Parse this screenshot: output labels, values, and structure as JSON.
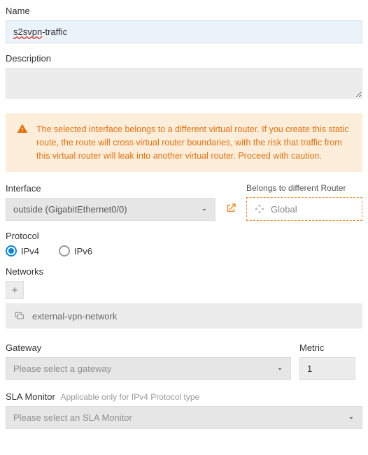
{
  "name": {
    "label": "Name",
    "value_part1": "s2svpn",
    "value_part2": "-traffic"
  },
  "description": {
    "label": "Description",
    "value": ""
  },
  "alert": {
    "text": "The selected interface belongs to a different virtual router. If you create this static route, the route will cross virtual router boundaries, with the risk that traffic from this virtual router will leak into another virtual router. Proceed with caution."
  },
  "interface": {
    "label": "Interface",
    "selected": "outside (GigabitEthernet0/0)"
  },
  "belongs": {
    "label": "Belongs to different Router",
    "value": "Global"
  },
  "protocol": {
    "label": "Protocol",
    "options": {
      "ipv4": "IPv4",
      "ipv6": "IPv6"
    }
  },
  "networks": {
    "label": "Networks",
    "items": [
      "external-vpn-network"
    ]
  },
  "gateway": {
    "label": "Gateway",
    "placeholder": "Please select a gateway"
  },
  "metric": {
    "label": "Metric",
    "value": "1"
  },
  "sla": {
    "label": "SLA Monitor",
    "hint": "Applicable only for IPv4 Protocol type",
    "placeholder": "Please select an SLA Monitor"
  }
}
